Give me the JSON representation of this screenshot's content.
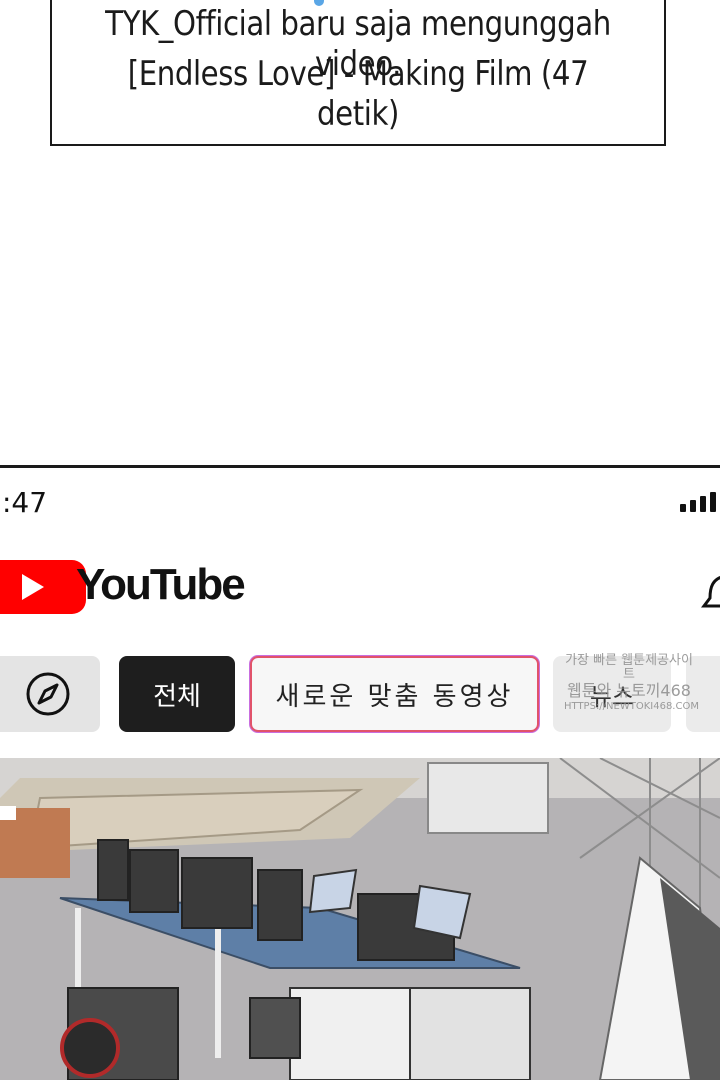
{
  "caption": {
    "line1": "TYK_Official baru saja mengunggah video.",
    "line2": "[Endless Love] - Making Film (47 detik)"
  },
  "status_bar": {
    "time": ":47",
    "signal_icon": "signal-bars-icon"
  },
  "header": {
    "logo_text": "YouTube",
    "logo_color": "#ff0000",
    "notification_icon": "bell-icon"
  },
  "chips": {
    "explore_icon": "compass-icon",
    "all": "전체",
    "new_for_you": "새로운 맞춤 동영상",
    "news": "뉴스"
  },
  "watermark": {
    "line1": "가장 빠른 웹툰제공사이트",
    "line2": "웹툰와 뉴토끼468",
    "line3": "HTTPS://NEWTOKI468.COM"
  },
  "video": {
    "thumbnail_description_icon": "video-thumbnail"
  }
}
